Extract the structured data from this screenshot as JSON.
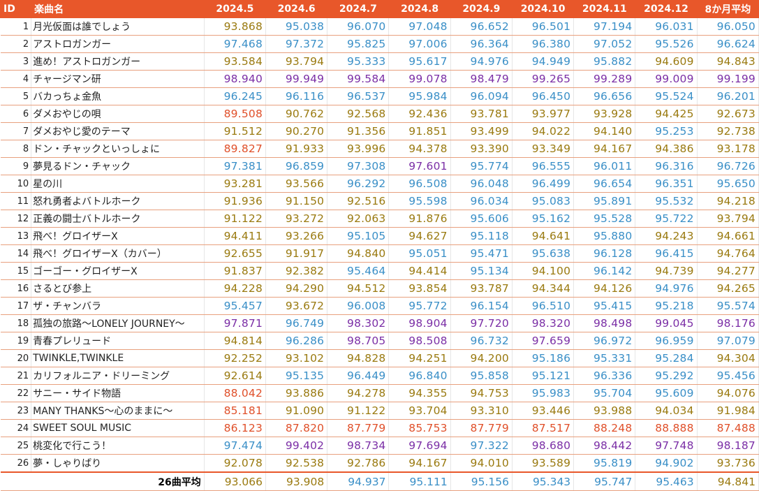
{
  "colors": {
    "header_bg": "#e8572a",
    "header_text": "#ffffff",
    "tier_purple": "#7b2fa6",
    "tier_blue": "#3a8fc7",
    "tier_olive": "#9a7a10",
    "tier_red": "#e0502a"
  },
  "headers": [
    "ID",
    "楽曲名",
    "2024.5",
    "2024.6",
    "2024.7",
    "2024.8",
    "2024.9",
    "2024.10",
    "2024.11",
    "2024.12",
    "8か月平均"
  ],
  "rows": [
    {
      "id": "1",
      "name": "月光仮面は誰でしょう",
      "values": [
        "93.868",
        "95.038",
        "96.070",
        "97.048",
        "96.652",
        "96.501",
        "97.194",
        "96.031",
        "96.050"
      ]
    },
    {
      "id": "2",
      "name": "アストロガンガー",
      "values": [
        "97.468",
        "97.372",
        "95.825",
        "97.006",
        "96.364",
        "96.380",
        "97.052",
        "95.526",
        "96.624"
      ]
    },
    {
      "id": "3",
      "name": "進め！アストロガンガー",
      "values": [
        "93.584",
        "93.794",
        "95.333",
        "95.617",
        "94.976",
        "94.949",
        "95.882",
        "94.609",
        "94.843"
      ]
    },
    {
      "id": "4",
      "name": "チャージマン研",
      "values": [
        "98.940",
        "99.949",
        "99.584",
        "99.078",
        "98.479",
        "99.265",
        "99.289",
        "99.009",
        "99.199"
      ]
    },
    {
      "id": "5",
      "name": "バカっちょ金魚",
      "values": [
        "96.245",
        "96.116",
        "96.537",
        "95.984",
        "96.094",
        "96.450",
        "96.656",
        "95.524",
        "96.201"
      ]
    },
    {
      "id": "6",
      "name": "ダメおやじの唄",
      "values": [
        "89.508",
        "90.762",
        "92.568",
        "92.436",
        "93.781",
        "93.977",
        "93.928",
        "94.425",
        "92.673"
      ]
    },
    {
      "id": "7",
      "name": "ダメおやじ愛のテーマ",
      "values": [
        "91.512",
        "90.270",
        "91.356",
        "91.851",
        "93.499",
        "94.022",
        "94.140",
        "95.253",
        "92.738"
      ]
    },
    {
      "id": "8",
      "name": "ドン・チャックといっしょに",
      "values": [
        "89.827",
        "91.933",
        "93.996",
        "94.378",
        "93.390",
        "93.349",
        "94.167",
        "94.386",
        "93.178"
      ]
    },
    {
      "id": "9",
      "name": "夢見るドン・チャック",
      "values": [
        "97.381",
        "96.859",
        "97.308",
        "97.601",
        "95.774",
        "96.555",
        "96.011",
        "96.316",
        "96.726"
      ]
    },
    {
      "id": "10",
      "name": "星の川",
      "values": [
        "93.281",
        "93.566",
        "96.292",
        "96.508",
        "96.048",
        "96.499",
        "96.654",
        "96.351",
        "95.650"
      ]
    },
    {
      "id": "11",
      "name": "怒れ勇者よバトルホーク",
      "values": [
        "91.936",
        "91.150",
        "92.516",
        "95.598",
        "96.034",
        "95.083",
        "95.891",
        "95.532",
        "94.218"
      ]
    },
    {
      "id": "12",
      "name": "正義の闘士バトルホーク",
      "values": [
        "91.122",
        "93.272",
        "92.063",
        "91.876",
        "95.606",
        "95.162",
        "95.528",
        "95.722",
        "93.794"
      ]
    },
    {
      "id": "13",
      "name": "飛べ！グロイザーX",
      "values": [
        "94.411",
        "93.266",
        "95.105",
        "94.627",
        "95.118",
        "94.641",
        "95.880",
        "94.243",
        "94.661"
      ]
    },
    {
      "id": "14",
      "name": "飛べ！グロイザーX（カバー）",
      "values": [
        "92.655",
        "91.917",
        "94.840",
        "95.051",
        "95.471",
        "95.638",
        "96.128",
        "96.415",
        "94.764"
      ]
    },
    {
      "id": "15",
      "name": "ゴーゴー・グロイザーX",
      "values": [
        "91.837",
        "92.382",
        "95.464",
        "94.414",
        "95.134",
        "94.100",
        "96.142",
        "94.739",
        "94.277"
      ]
    },
    {
      "id": "16",
      "name": "さるとび参上",
      "values": [
        "94.228",
        "94.290",
        "94.512",
        "93.854",
        "93.787",
        "94.344",
        "94.126",
        "94.976",
        "94.265"
      ]
    },
    {
      "id": "17",
      "name": "ザ・チャンバラ",
      "values": [
        "95.457",
        "93.672",
        "96.008",
        "95.772",
        "96.154",
        "96.510",
        "95.415",
        "95.218",
        "95.574"
      ]
    },
    {
      "id": "18",
      "name": "孤独の旅路〜LONELY JOURNEY〜",
      "values": [
        "97.871",
        "96.749",
        "98.302",
        "98.904",
        "97.720",
        "98.320",
        "98.498",
        "99.045",
        "98.176"
      ]
    },
    {
      "id": "19",
      "name": "青春プレリュード",
      "values": [
        "94.814",
        "96.286",
        "98.705",
        "98.508",
        "96.732",
        "97.659",
        "96.972",
        "96.959",
        "97.079"
      ]
    },
    {
      "id": "20",
      "name": "TWINKLE,TWINKLE",
      "values": [
        "92.252",
        "93.102",
        "94.828",
        "94.251",
        "94.200",
        "95.186",
        "95.331",
        "95.284",
        "94.304"
      ]
    },
    {
      "id": "21",
      "name": "カリフォルニア・ドリーミング",
      "values": [
        "92.614",
        "95.135",
        "96.449",
        "96.840",
        "95.858",
        "95.121",
        "96.336",
        "95.292",
        "95.456"
      ]
    },
    {
      "id": "22",
      "name": "サニー・サイド物語",
      "values": [
        "88.042",
        "93.886",
        "94.278",
        "94.355",
        "94.753",
        "95.983",
        "95.704",
        "95.609",
        "94.076"
      ]
    },
    {
      "id": "23",
      "name": "MANY THANKS〜心のままに〜",
      "values": [
        "85.181",
        "91.090",
        "91.122",
        "93.704",
        "93.310",
        "93.446",
        "93.988",
        "94.034",
        "91.984"
      ]
    },
    {
      "id": "24",
      "name": "SWEET SOUL MUSIC",
      "values": [
        "86.123",
        "87.820",
        "87.779",
        "85.753",
        "87.779",
        "87.517",
        "88.248",
        "88.888",
        "87.488"
      ]
    },
    {
      "id": "25",
      "name": "桃変化で行こう！",
      "values": [
        "97.474",
        "99.402",
        "98.734",
        "97.694",
        "97.322",
        "98.680",
        "98.442",
        "97.748",
        "98.187"
      ]
    },
    {
      "id": "26",
      "name": "夢・しゃりばり",
      "values": [
        "92.078",
        "92.538",
        "92.786",
        "94.167",
        "94.010",
        "93.589",
        "95.819",
        "94.902",
        "93.736"
      ]
    }
  ],
  "footer": {
    "label": "26曲平均",
    "values": [
      "93.066",
      "93.908",
      "94.937",
      "95.111",
      "95.156",
      "95.343",
      "95.747",
      "95.463",
      "94.841"
    ]
  }
}
